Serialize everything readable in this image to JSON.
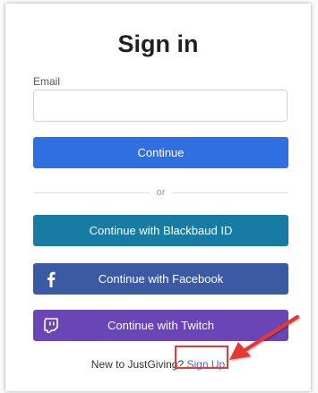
{
  "signin": {
    "title": "Sign in",
    "email_label": "Email",
    "email_value": "",
    "email_placeholder": "",
    "continue_label": "Continue",
    "divider_text": "or",
    "blackbaud_label": "Continue with Blackbaud ID",
    "facebook_label": "Continue with Facebook",
    "twitch_label": "Continue with Twitch",
    "new_user_text": "New to JustGiving?",
    "signup_label": "Sign Up"
  },
  "icons": {
    "facebook": "facebook-icon",
    "twitch": "twitch-icon",
    "annotation_arrow": "arrow-icon"
  },
  "colors": {
    "primary": "#2f6fe0",
    "blackbaud": "#177ba3",
    "facebook": "#3b5aa3",
    "twitch": "#6a45b5",
    "annotation": "#e53935"
  }
}
